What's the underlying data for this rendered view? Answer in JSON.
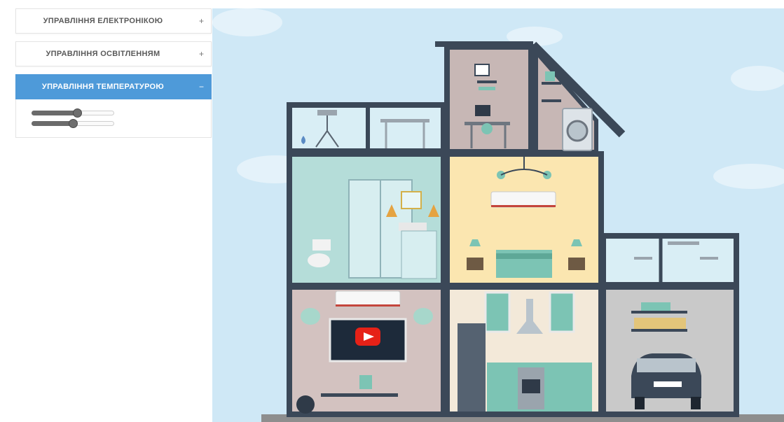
{
  "menu": {
    "items": [
      {
        "label": "УПРАВЛІННЯ ЕЛЕКТРОНІКОЮ",
        "toggle": "+"
      },
      {
        "label": "УПРАВЛІННЯ ОСВІТЛЕННЯМ",
        "toggle": "+"
      },
      {
        "label": "УПРАВЛІННЯ ТЕМПЕРАТУРОЮ",
        "toggle": "−",
        "expanded": true
      }
    ]
  },
  "temperature_sliders": [
    {
      "value_fraction": 0.55
    },
    {
      "value_fraction": 0.5
    }
  ],
  "colors": {
    "accent": "#4e9ad9",
    "sky": "#cfe8f6",
    "house_frame": "#3b4858",
    "bedroom_wall": "#fbe6b0",
    "bathroom_wall": "#b5ddd9",
    "kitchen_wall": "#f3e9d9",
    "living_wall": "#d3c2c0",
    "garage_wall": "#c9c9c9",
    "furniture": "#7cc4b4"
  },
  "scene": {
    "ac_units": [
      {
        "display": "1"
      },
      {
        "display": "1"
      }
    ],
    "tv_icon": "youtube-play-icon"
  }
}
